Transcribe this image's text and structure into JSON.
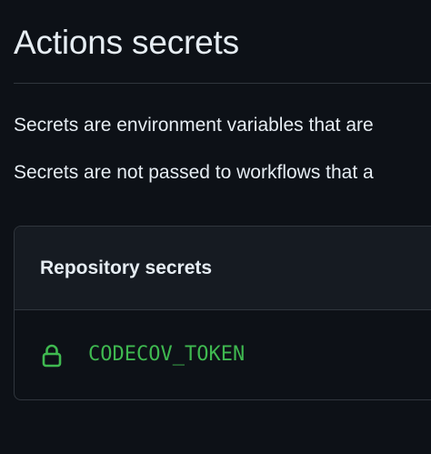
{
  "page": {
    "title": "Actions secrets",
    "description_lines": [
      "Secrets are environment variables that are",
      "Secrets are not passed to workflows that a"
    ]
  },
  "repository_secrets": {
    "header": "Repository secrets",
    "items": [
      {
        "name": "CODECOV_TOKEN",
        "icon": "lock-icon"
      }
    ]
  },
  "colors": {
    "background": "#0d1117",
    "header_background": "#161b22",
    "border": "#30363d",
    "text": "#e6edf3",
    "secret_green": "#3fb950"
  }
}
